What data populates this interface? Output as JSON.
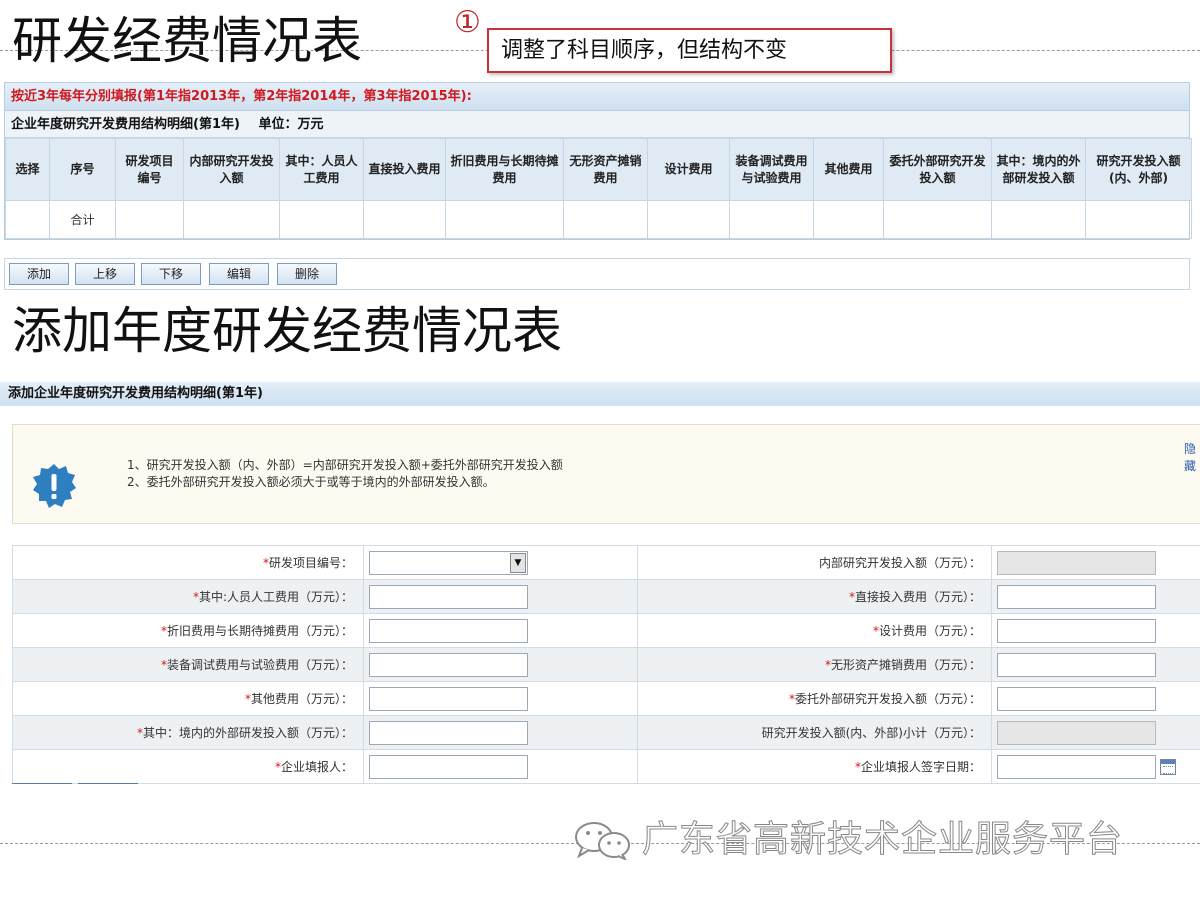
{
  "titles": {
    "top": "研发经费情况表",
    "bottom": "添加年度研发经费情况表"
  },
  "annotation": {
    "marker": "①",
    "text": "调整了科目顺序，但结构不变"
  },
  "top_panel": {
    "notice": "按近3年每年分别填报(第1年指2013年，第2年指2014年，第3年指2015年):",
    "subtitle": "企业年度研究开发费用结构明细(第1年)",
    "unit": "单位：万元",
    "columns": [
      "选择",
      "序号",
      "研发项目编号",
      "内部研究开发投入额",
      "其中：人员人工费用",
      "直接投入费用",
      "折旧费用与长期待摊费用",
      "无形资产摊销费用",
      "设计费用",
      "装备调试费用与试验费用",
      "其他费用",
      "委托外部研究开发投入额",
      "其中：境内的外部研发投入额",
      "研究开发投入额(内、外部)"
    ],
    "total_row_label": "合计"
  },
  "buttons": [
    "添加",
    "上移",
    "下移",
    "编辑",
    "删除"
  ],
  "form": {
    "header": "添加企业年度研究开发费用结构明细(第1年)",
    "hide_link": "隐藏",
    "notes": [
      "1、研究开发投入额（内、外部）=内部研究开发投入额+委托外部研究开发投入额",
      "2、委托外部研究开发投入额必须大于或等于境内的外部研发投入额。"
    ],
    "rows": [
      {
        "l_label": "研发项目编号：",
        "l_req": true,
        "l_type": "select",
        "r_label": "内部研究开发投入额（万元）：",
        "r_req": false,
        "r_type": "readonly"
      },
      {
        "l_label": "其中:人员人工费用（万元）：",
        "l_req": true,
        "l_type": "text",
        "r_label": "直接投入费用（万元）：",
        "r_req": true,
        "r_type": "text"
      },
      {
        "l_label": "折旧费用与长期待摊费用（万元）：",
        "l_req": true,
        "l_type": "text",
        "r_label": "设计费用（万元）：",
        "r_req": true,
        "r_type": "text"
      },
      {
        "l_label": "装备调试费用与试验费用（万元）：",
        "l_req": true,
        "l_type": "text",
        "r_label": "无形资产摊销费用（万元）：",
        "r_req": true,
        "r_type": "text"
      },
      {
        "l_label": "其他费用（万元）：",
        "l_req": true,
        "l_type": "text",
        "r_label": "委托外部研究开发投入额（万元）：",
        "r_req": true,
        "r_type": "text"
      },
      {
        "l_label": "其中：境内的外部研发投入额（万元）：",
        "l_req": true,
        "l_type": "text",
        "r_label": "研究开发投入额(内、外部)小计（万元）：",
        "r_req": false,
        "r_type": "readonly"
      },
      {
        "l_label": "企业填报人：",
        "l_req": true,
        "l_type": "text",
        "r_label": "企业填报人签字日期：",
        "r_req": true,
        "r_type": "date"
      }
    ]
  },
  "watermark": "广东省高新技术企业服务平台",
  "colors": {
    "accent_red": "#d0191e",
    "callout_border": "#c8323c",
    "header_blue": "#dfeaf5",
    "note_icon_blue": "#2e7fc0"
  }
}
